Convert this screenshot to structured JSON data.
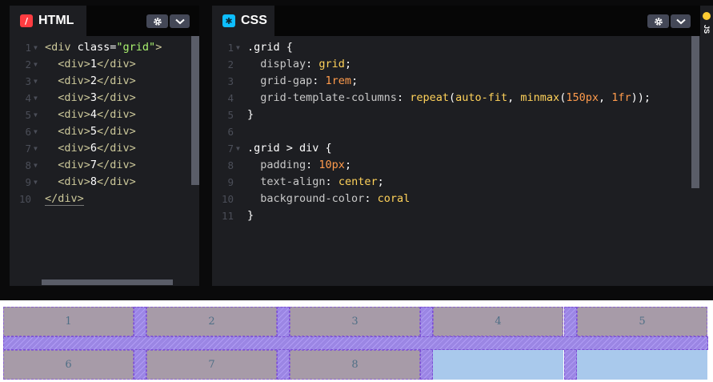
{
  "html_pane": {
    "tab_label": "HTML",
    "icon": "slash-icon",
    "icon_color": "#ff3c41",
    "lines": [
      {
        "n": "1",
        "fold": true,
        "segs": [
          [
            "t-tag",
            "<div "
          ],
          [
            "t-attr",
            "class"
          ],
          [
            "t-punc",
            "="
          ],
          [
            "t-str",
            "\"grid\""
          ],
          [
            "t-tag",
            ">"
          ]
        ]
      },
      {
        "n": "2",
        "fold": true,
        "segs": [
          [
            "t-tag",
            "  <div>"
          ],
          [
            "t-plain",
            "1"
          ],
          [
            "t-tag",
            "</div>"
          ]
        ]
      },
      {
        "n": "3",
        "fold": true,
        "segs": [
          [
            "t-tag",
            "  <div>"
          ],
          [
            "t-plain",
            "2"
          ],
          [
            "t-tag",
            "</div>"
          ]
        ]
      },
      {
        "n": "4",
        "fold": true,
        "segs": [
          [
            "t-tag",
            "  <div>"
          ],
          [
            "t-plain",
            "3"
          ],
          [
            "t-tag",
            "</div>"
          ]
        ]
      },
      {
        "n": "5",
        "fold": true,
        "segs": [
          [
            "t-tag",
            "  <div>"
          ],
          [
            "t-plain",
            "4"
          ],
          [
            "t-tag",
            "</div>"
          ]
        ]
      },
      {
        "n": "6",
        "fold": true,
        "segs": [
          [
            "t-tag",
            "  <div>"
          ],
          [
            "t-plain",
            "5"
          ],
          [
            "t-tag",
            "</div>"
          ]
        ]
      },
      {
        "n": "7",
        "fold": true,
        "segs": [
          [
            "t-tag",
            "  <div>"
          ],
          [
            "t-plain",
            "6"
          ],
          [
            "t-tag",
            "</div>"
          ]
        ]
      },
      {
        "n": "8",
        "fold": true,
        "segs": [
          [
            "t-tag",
            "  <div>"
          ],
          [
            "t-plain",
            "7"
          ],
          [
            "t-tag",
            "</div>"
          ]
        ]
      },
      {
        "n": "9",
        "fold": true,
        "segs": [
          [
            "t-tag",
            "  <div>"
          ],
          [
            "t-plain",
            "8"
          ],
          [
            "t-tag",
            "</div>"
          ]
        ]
      },
      {
        "n": "10",
        "fold": false,
        "segs": [
          [
            "t-tag under",
            "</div>"
          ]
        ]
      }
    ]
  },
  "css_pane": {
    "tab_label": "CSS",
    "icon": "asterisk-icon",
    "icon_color": "#0ebeff",
    "lines": [
      {
        "n": "1",
        "fold": true,
        "segs": [
          [
            "t-sel",
            ".grid "
          ],
          [
            "t-punc",
            "{"
          ]
        ]
      },
      {
        "n": "2",
        "fold": false,
        "segs": [
          [
            "t-prop",
            "  display"
          ],
          [
            "t-punc",
            ": "
          ],
          [
            "t-val",
            "grid"
          ],
          [
            "t-punc",
            ";"
          ]
        ]
      },
      {
        "n": "3",
        "fold": false,
        "segs": [
          [
            "t-prop",
            "  grid-gap"
          ],
          [
            "t-punc",
            ": "
          ],
          [
            "t-num",
            "1rem"
          ],
          [
            "t-punc",
            ";"
          ]
        ]
      },
      {
        "n": "4",
        "fold": false,
        "segs": [
          [
            "t-prop",
            "  grid-template-columns"
          ],
          [
            "t-punc",
            ": "
          ],
          [
            "t-val",
            "repeat"
          ],
          [
            "t-punc",
            "("
          ],
          [
            "t-val",
            "auto-fit"
          ],
          [
            "t-punc",
            ", "
          ],
          [
            "t-val",
            "minmax"
          ],
          [
            "t-punc",
            "("
          ],
          [
            "t-num",
            "150px"
          ],
          [
            "t-punc",
            ", "
          ],
          [
            "t-num",
            "1fr"
          ],
          [
            "t-punc",
            "));"
          ]
        ]
      },
      {
        "n": "5",
        "fold": false,
        "segs": [
          [
            "t-punc",
            "}"
          ]
        ]
      },
      {
        "n": "6",
        "fold": false,
        "segs": []
      },
      {
        "n": "7",
        "fold": true,
        "segs": [
          [
            "t-sel",
            ".grid > div "
          ],
          [
            "t-punc",
            "{"
          ]
        ]
      },
      {
        "n": "8",
        "fold": false,
        "segs": [
          [
            "t-prop",
            "  padding"
          ],
          [
            "t-punc",
            ": "
          ],
          [
            "t-num",
            "10px"
          ],
          [
            "t-punc",
            ";"
          ]
        ]
      },
      {
        "n": "9",
        "fold": false,
        "segs": [
          [
            "t-prop",
            "  text-align"
          ],
          [
            "t-punc",
            ": "
          ],
          [
            "t-val",
            "center"
          ],
          [
            "t-punc",
            ";"
          ]
        ]
      },
      {
        "n": "10",
        "fold": false,
        "segs": [
          [
            "t-prop",
            "  background-color"
          ],
          [
            "t-punc",
            ": "
          ],
          [
            "t-val",
            "coral"
          ]
        ]
      },
      {
        "n": "11",
        "fold": false,
        "segs": [
          [
            "t-punc",
            "}"
          ]
        ]
      }
    ]
  },
  "js_strip": {
    "label": "JS",
    "dot_color": "#ffcc33"
  },
  "preview": {
    "cells": [
      "1",
      "2",
      "3",
      "4",
      "5",
      "6",
      "7",
      "8"
    ],
    "columns": 5,
    "cell_color": "#a79ba8",
    "empty_color": "#a9c9ec",
    "gap_color": "#9b86e4"
  }
}
